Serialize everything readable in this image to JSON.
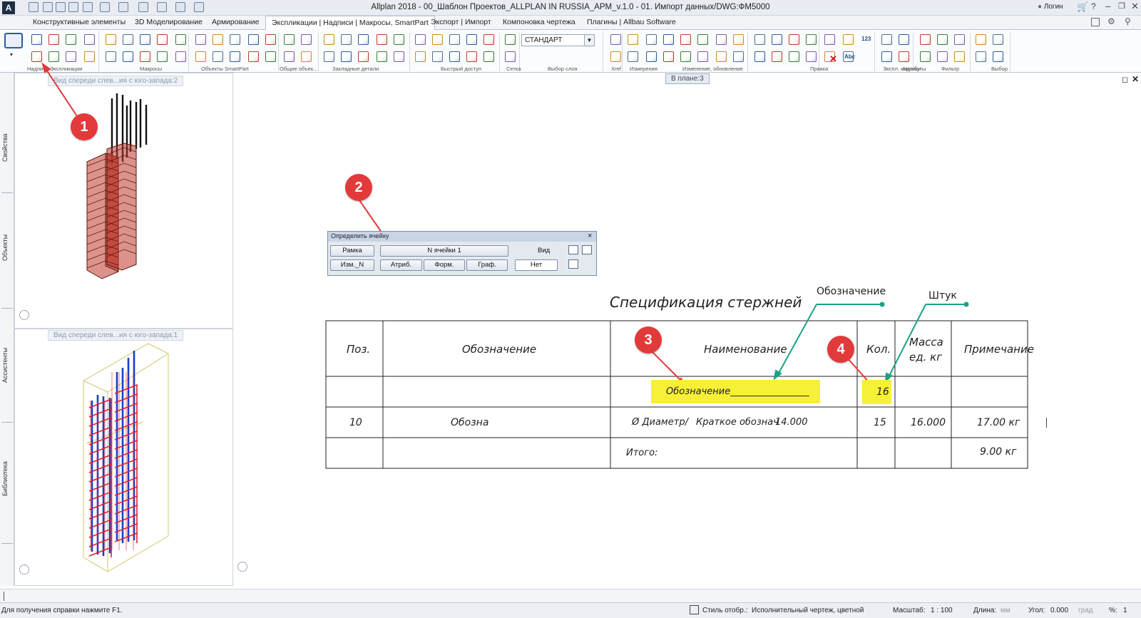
{
  "app": {
    "title": "Allplan 2018 - 00_Шаблон Проектов_ALLPLAN IN RUSSIA_APM_v.1.0 - 01. Импорт данных/DWG:ФМ5000",
    "logo": "A",
    "user": "Логин"
  },
  "tabs": [
    {
      "label": "Конструктивные элементы"
    },
    {
      "label": "3D Моделирование"
    },
    {
      "label": "Армирование"
    },
    {
      "label": "Экспликации | Надписи | Макросы, SmartPart",
      "active": true
    },
    {
      "label": "Экспорт | Импорт"
    },
    {
      "label": "Компоновка чертежа"
    },
    {
      "label": "Плагины | Allbau Software"
    }
  ],
  "ribbon": {
    "groups": [
      "Надпись",
      "Экспликации",
      "Макросы",
      "Объекты SmartPart",
      "Общие объек...",
      "Закладные детали",
      "Быстрый доступ",
      "Сетка",
      "Выбор слоя",
      "Xref",
      "Измерения",
      "Изменение, обновление",
      "Правка",
      "Экспл. надписи",
      "Атрибуты",
      "Фильтр",
      "Выбор"
    ],
    "layer_value": "СТАНДАРТ",
    "icon_num": "123",
    "icon_abc": "Abc"
  },
  "sidebar": {
    "tabs": [
      "Свойства",
      "Объекты",
      "Ассистенты",
      "Библиотека"
    ]
  },
  "views": {
    "top_label": "Вид спереди слев...ия с юго-запада:2",
    "bottom_label": "Вид спереди слев...ия с юго-запада:1",
    "main_label": "В плане:3"
  },
  "dialog": {
    "title": "Определить ячейку",
    "close": "×",
    "btn_frame": "Рамка",
    "cell_no": "N ячейки   1",
    "view_label": "Вид",
    "btn_change": "Изм._N",
    "btn_attr": "Атриб.",
    "btn_form": "Форм.",
    "btn_graph": "Граф.",
    "no_value": "Нет"
  },
  "drawing": {
    "title": "Спецификация стержней",
    "headers": [
      "Поз.",
      "Обозначение",
      "Наименование",
      "Кол.",
      "Масса ед. кг",
      "Примечание"
    ],
    "header_mass_line1": "Масса",
    "header_mass_line2": "ед. кг",
    "attr_row": {
      "designation": "Обозначение_________________",
      "qty": "16"
    },
    "data_row": {
      "pos": "10",
      "designation": "Обозна",
      "diameter": "Ø Диаметр/",
      "short": "Краткое обознач",
      "length": "14.000",
      "qty": "15",
      "mass": "16.000",
      "note": "17.00 кг"
    },
    "total_row": {
      "label": "Итого:",
      "value": "9.00 кг"
    },
    "callouts": {
      "designation": "Обозначение",
      "pieces": "Штук"
    }
  },
  "badges": [
    "1",
    "2",
    "3",
    "4"
  ],
  "status": {
    "help": "Для получения справки нажмите F1.",
    "style_label": "Стиль отобр.:",
    "style_value": "Исполнительный чертеж, цветной",
    "scale_label": "Масштаб:",
    "scale_value": "1 : 100",
    "length_label": "Длина:",
    "length_unit": "мм",
    "angle_label": "Угол:",
    "angle_value": "0.000",
    "angle_unit": "град",
    "percent_label": "%:",
    "percent_value": "1"
  },
  "colors": {
    "accent_red": "#e23a3a",
    "highlight": "#f6f136",
    "callout": "#1aa186",
    "bar_red": "#c0392b",
    "bar_blue": "#1f3cc8"
  }
}
